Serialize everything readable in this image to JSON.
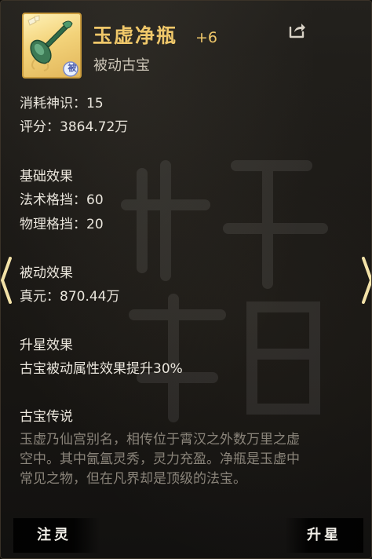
{
  "item": {
    "name": "玉虚净瓶",
    "level": "+6",
    "type": "被动古宝",
    "badge": "被",
    "icon": "jade-vase-icon"
  },
  "stats": {
    "cost": "消耗神识：15",
    "score": "评分：3864.72万"
  },
  "base_effects": {
    "heading": "基础效果",
    "lines": [
      "法术格挡：60",
      "物理格挡：20"
    ]
  },
  "passive_effects": {
    "heading": "被动效果",
    "lines": [
      "真元：870.44万"
    ]
  },
  "star_effects": {
    "heading": "升星效果",
    "lines": [
      "古宝被动属性效果提升30%"
    ]
  },
  "lore": {
    "heading": "古宝传说",
    "lines": [
      "玉虚乃仙宫别名，相传位于霄汉之外数万里之虚",
      "空中。其中氤氲灵秀，灵力充盈。净瓶是玉虚中",
      "常见之物，但在凡界却是顶级的法宝。"
    ]
  },
  "buttons": {
    "infuse": "注灵",
    "star_up": "升星"
  },
  "colors": {
    "name": "#f0c86a",
    "lore": "#8a847a",
    "text": "#e9e5dc"
  }
}
